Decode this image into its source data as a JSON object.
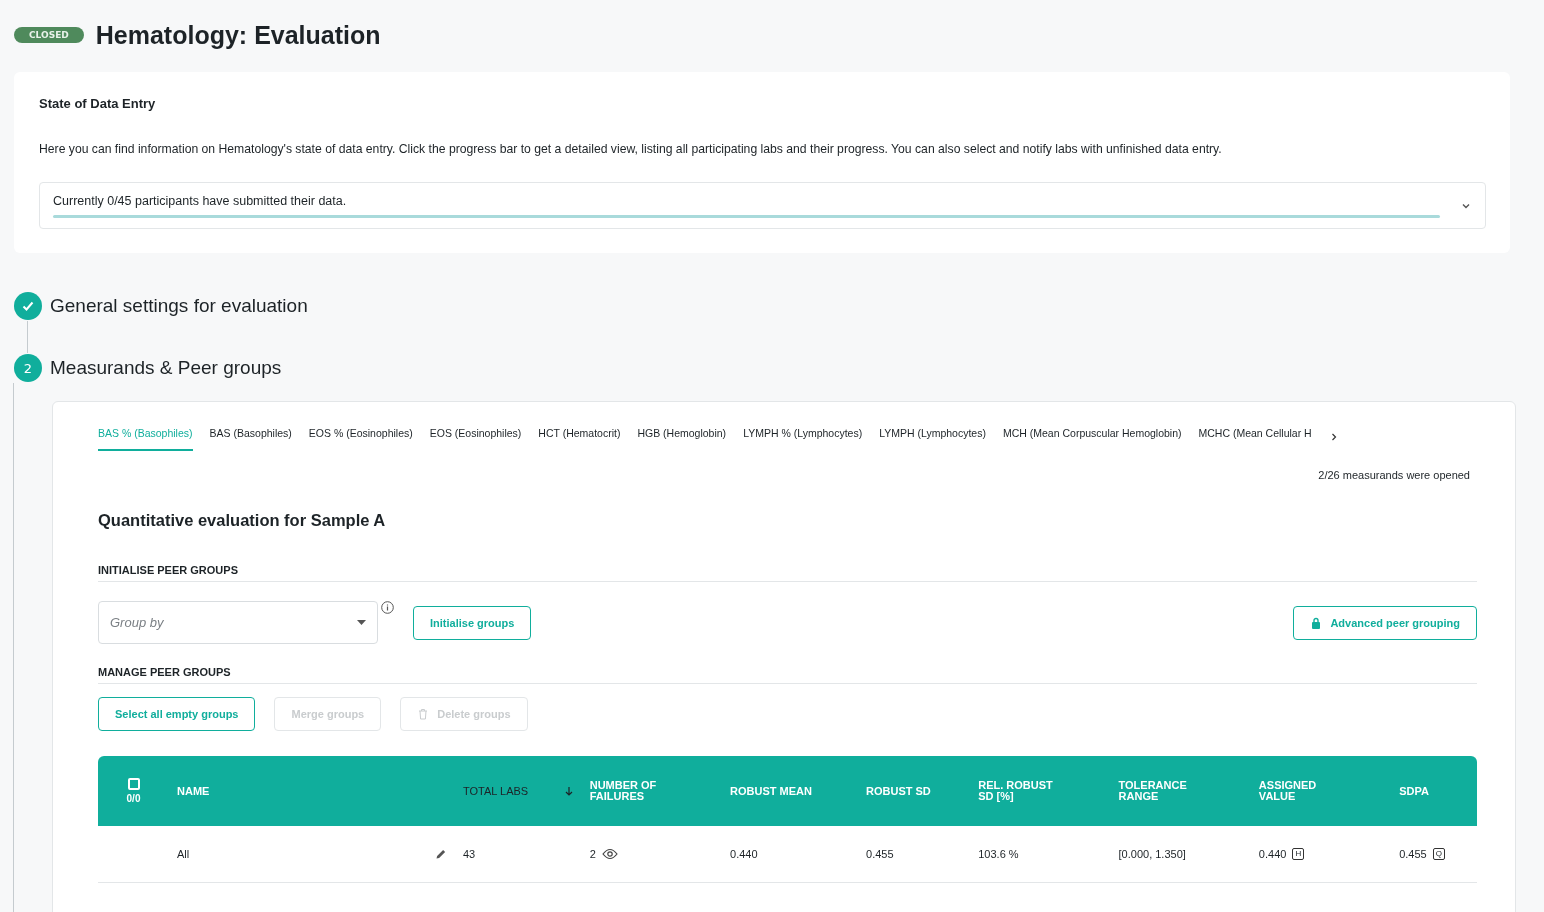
{
  "header": {
    "status_badge": "CLOSED",
    "title": "Hematology: Evaluation"
  },
  "data_entry": {
    "title": "State of Data Entry",
    "description": "Here you can find information on Hematology's state of data entry. Click the progress bar to get a detailed view, listing all participating labs and their progress. You can also select and notify labs with unfinished data entry.",
    "progress_text": "Currently 0/45 participants have submitted their data.",
    "level": 0,
    "expanded": false
  },
  "steps": [
    {
      "kind": "done",
      "title": "General settings for evaluation"
    },
    {
      "kind": "number",
      "number": "2",
      "title": "Measurands & Peer groups"
    }
  ],
  "tabs": [
    {
      "label": "BAS % (Basophiles)",
      "selected": true
    },
    {
      "label": "BAS (Basophiles)",
      "selected": false
    },
    {
      "label": "EOS % (Eosinophiles)",
      "selected": false
    },
    {
      "label": "EOS (Eosinophiles)",
      "selected": false
    },
    {
      "label": "HCT (Hematocrit)",
      "selected": false
    },
    {
      "label": "HGB (Hemoglobin)",
      "selected": false
    },
    {
      "label": "LYMPH % (Lymphocytes)",
      "selected": false
    },
    {
      "label": "LYMPH (Lymphocytes)",
      "selected": false
    },
    {
      "label": "MCH (Mean Corpuscular Hemoglobin)",
      "selected": false
    },
    {
      "label": "MCHC (Mean Cellular H",
      "selected": false
    }
  ],
  "measurands_opened": "2/26 measurands were opened",
  "section_title": "Quantitative evaluation for Sample A",
  "initialise": {
    "heading": "INITIALISE PEER GROUPS",
    "group_by_placeholder": "Group by",
    "initialise_button": "Initialise groups",
    "advanced_button": "Advanced peer grouping"
  },
  "manage": {
    "heading": "MANAGE PEER GROUPS",
    "buttons": [
      {
        "label": "Select all empty groups",
        "disabled": false,
        "kind": "plain"
      },
      {
        "label": "Merge groups",
        "disabled": true,
        "kind": "plain"
      },
      {
        "label": "Delete groups",
        "disabled": true,
        "kind": "delete"
      }
    ]
  },
  "table": {
    "select_count": "0/0",
    "select_all_checked": false,
    "columns": [
      {
        "label": "NAME",
        "sorted": false
      },
      {
        "label": "TOTAL LABS",
        "sorted": true
      },
      {
        "label": "NUMBER OF FAILURES",
        "sorted": false
      },
      {
        "label": "ROBUST MEAN",
        "sorted": false
      },
      {
        "label": "ROBUST SD",
        "sorted": false
      },
      {
        "label": "REL. ROBUST SD [%]",
        "sorted": false
      },
      {
        "label": "TOLERANCE RANGE",
        "sorted": false
      },
      {
        "label": "ASSIGNED VALUE",
        "sorted": false
      },
      {
        "label": "SDPA",
        "sorted": false
      }
    ],
    "rows": [
      {
        "name": "All",
        "total_labs": "43",
        "failures": "2",
        "robust_mean": "0.440",
        "robust_sd": "0.455",
        "rel_robust_sd": "103.6 %",
        "tolerance_range": "[0.000, 1.350]",
        "assigned_value": "0.440",
        "assigned_tag": "H",
        "sdpa": "0.455",
        "sdpa_tag": "Q"
      }
    ]
  }
}
